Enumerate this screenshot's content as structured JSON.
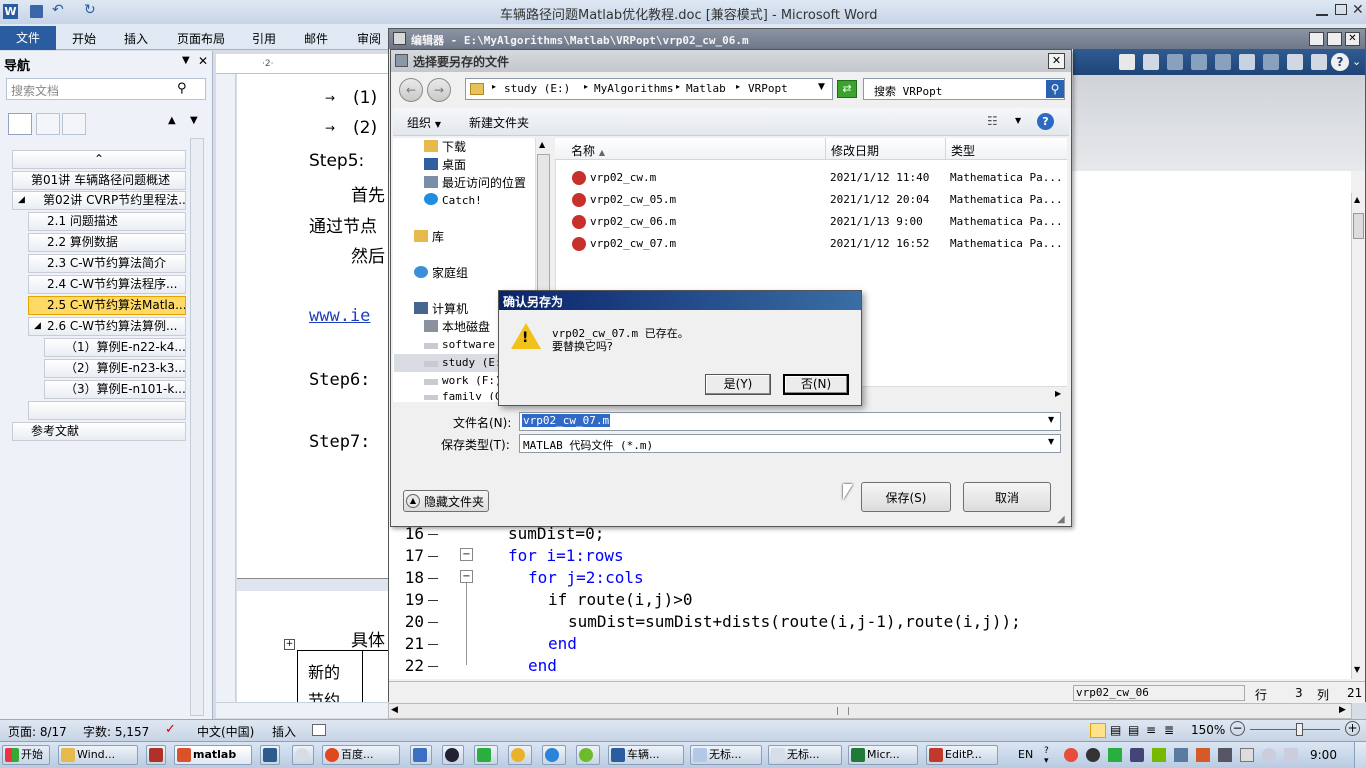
{
  "word": {
    "title": "车辆路径问题Matlab优化教程.doc [兼容模式] - Microsoft Word",
    "tabs": [
      "文件",
      "开始",
      "插入",
      "页面布局",
      "引用",
      "邮件",
      "审阅"
    ],
    "nav": {
      "title": "导航",
      "search_placeholder": "搜索文档",
      "items": [
        "第01讲 车辆路径问题概述",
        "第02讲 CVRP节约里程法...",
        "2.1 问题描述",
        "2.2 算例数据",
        "2.3 C-W节约算法简介",
        "2.4 C-W节约算法程序...",
        "2.5 C-W节约算法Matla...",
        "2.6 C-W节约算法算例...",
        "（1）算例E-n22-k4...",
        "（2）算例E-n23-k3...",
        "（3）算例E-n101-k...",
        "参考文献"
      ]
    },
    "doc": {
      "line1": "(1)",
      "line2": "(2)",
      "step5": "Step5:",
      "p1": "首先",
      "p2": "通过节点",
      "p3": "然后",
      "link": "www.ie",
      "step6": "Step6:",
      "step7": "Step7:",
      "p4": "具体",
      "cell1": "新的",
      "cell2": "节约"
    },
    "status": {
      "page": "页面: 8/17",
      "words": "字数: 5,157",
      "lang": "中文(中国)",
      "mode": "插入",
      "zoom": "150%"
    }
  },
  "editor": {
    "title": "编辑器 - E:\\MyAlgorithms\\Matlab\\VRPopt\\vrp02_cw_06.m",
    "code_lines": [
      {
        "num": "16",
        "text": "sumDist=0;"
      },
      {
        "num": "17",
        "text": "for i=1:rows"
      },
      {
        "num": "18",
        "text": "for j=2:cols"
      },
      {
        "num": "19",
        "text": "if route(i,j)>0"
      },
      {
        "num": "20",
        "text": "sumDist=sumDist+dists(route(i,j-1),route(i,j));"
      },
      {
        "num": "21",
        "text": "end"
      },
      {
        "num": "22",
        "text": "end"
      }
    ],
    "status_file": "vrp02_cw_06",
    "row_label": "行",
    "row_value": "3",
    "col_label": "列",
    "col_value": "21"
  },
  "save_dialog": {
    "title": "选择要另存的文件",
    "breadcrumb": [
      "study (E:)",
      "MyAlgorithms",
      "Matlab",
      "VRPopt"
    ],
    "search_placeholder": "搜索 VRPopt",
    "organize": "组织",
    "new_folder": "新建文件夹",
    "tree": [
      "下载",
      "桌面",
      "最近访问的位置",
      "Catch!",
      "库",
      "家庭组",
      "计算机",
      "本地磁盘",
      "software",
      "study (E:",
      "work (F:)",
      "family (G"
    ],
    "columns": [
      "名称",
      "修改日期",
      "类型"
    ],
    "files": [
      {
        "name": "vrp02_cw.m",
        "date": "2021/1/12 11:40",
        "type": "Mathematica Pa..."
      },
      {
        "name": "vrp02_cw_05.m",
        "date": "2021/1/12 20:04",
        "type": "Mathematica Pa..."
      },
      {
        "name": "vrp02_cw_06.m",
        "date": "2021/1/13 9:00",
        "type": "Mathematica Pa..."
      },
      {
        "name": "vrp02_cw_07.m",
        "date": "2021/1/12 16:52",
        "type": "Mathematica Pa..."
      }
    ],
    "filename_label": "文件名(N):",
    "filename_value": "vrp02_cw_07.m",
    "filetype_label": "保存类型(T):",
    "filetype_value": "MATLAB 代码文件 (*.m)",
    "hide_folders": "隐藏文件夹",
    "save": "保存(S)",
    "cancel": "取消"
  },
  "confirm": {
    "title": "确认另存为",
    "message1": "vrp02_cw_07.m 已存在。",
    "message2": "要替换它吗?",
    "yes": "是(Y)",
    "no": "否(N)"
  },
  "taskbar": {
    "start": "开始",
    "items": [
      "Wind...",
      "",
      "matlab",
      "",
      "百度...",
      "",
      "",
      "",
      "",
      "",
      "车辆...",
      "无标...",
      "无标...",
      "Micr...",
      "EditP..."
    ],
    "lang": "EN",
    "time": "9:00"
  },
  "colors": {
    "word_blue": "#2a5d9f",
    "nav_selected": "#ffd966",
    "dialog_title_active": "#0a246a",
    "code_keyword": "#0000ff"
  }
}
